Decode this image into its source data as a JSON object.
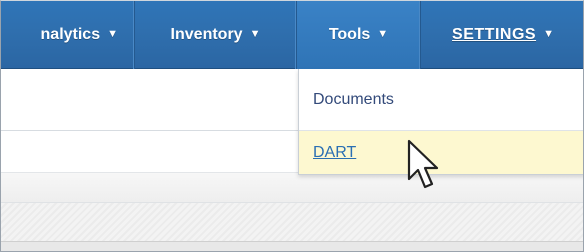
{
  "navbar": {
    "items": [
      {
        "label": "nalytics",
        "caret": "▼"
      },
      {
        "label": "Inventory",
        "caret": "▼"
      },
      {
        "label": "Tools",
        "caret": "▼"
      },
      {
        "label": "SETTINGS",
        "caret": "▼"
      }
    ]
  },
  "tools_menu": {
    "items": [
      {
        "label": "Documents"
      },
      {
        "label": "DART"
      }
    ]
  },
  "colors": {
    "navbar_blue": "#2f6fae",
    "hover_yellow": "#fdf8d0",
    "link_blue": "#2a6fb3"
  },
  "icons": {
    "cursor": "mouse-pointer-icon",
    "caret": "caret-down-icon"
  }
}
